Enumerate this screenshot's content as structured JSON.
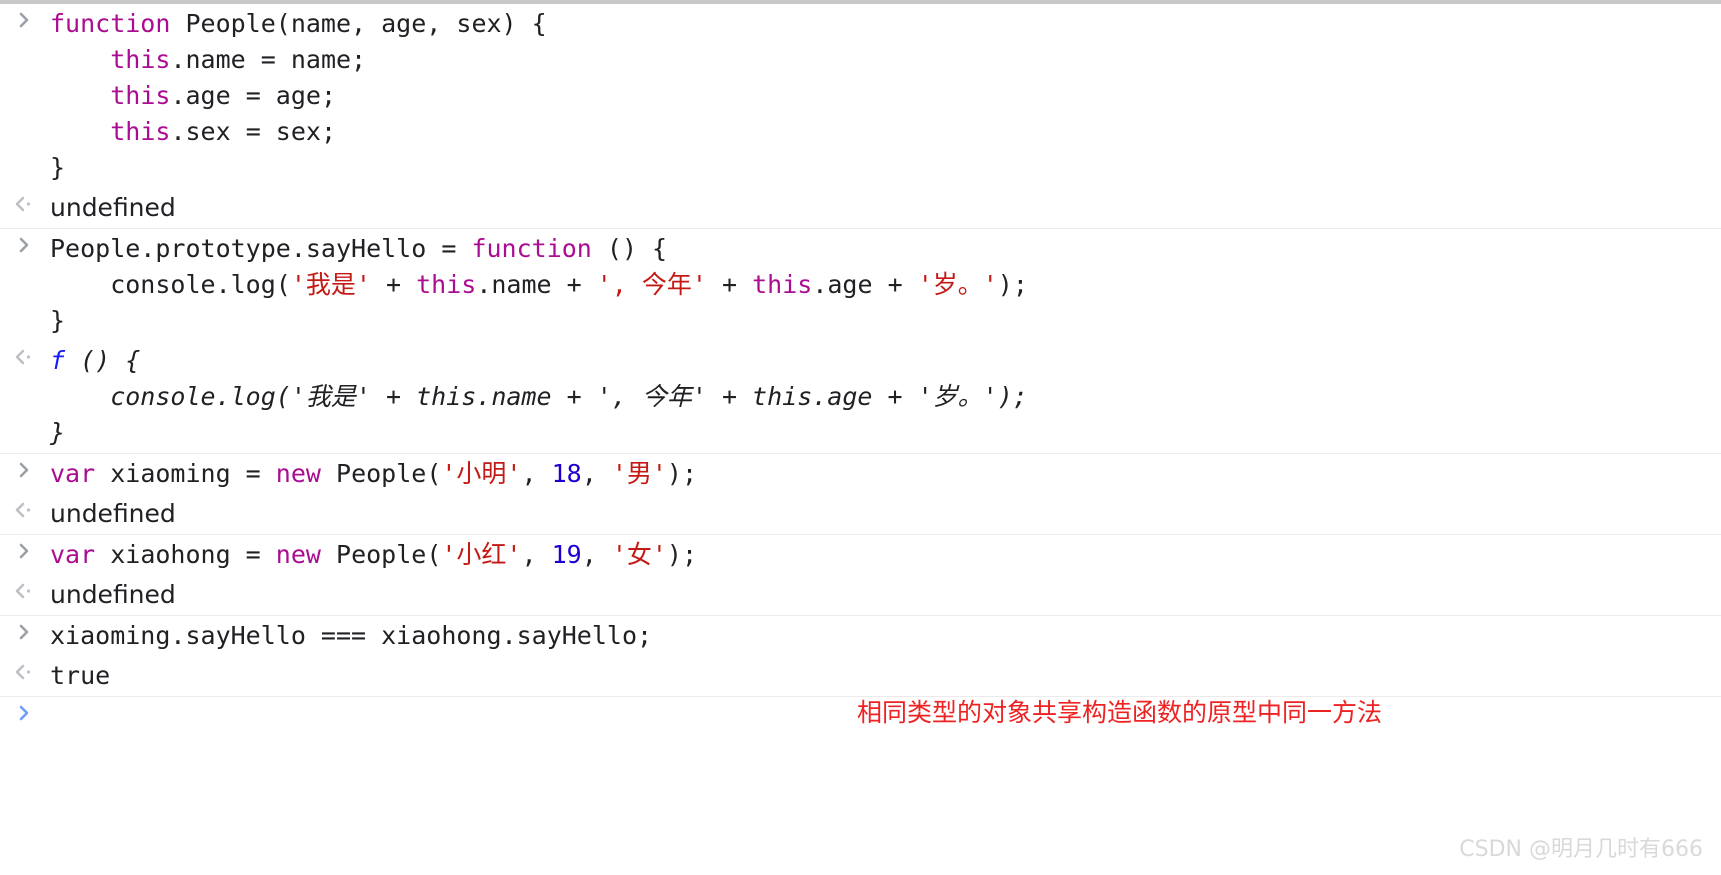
{
  "app": {
    "name": "Chrome DevTools Console",
    "theme": "light"
  },
  "colors": {
    "keyword": "#aa0d91",
    "string": "#c41a16",
    "number": "#1c00cf",
    "plain": "#202124",
    "result_muted": "#9aa0a6",
    "boolean": "#1c00cf",
    "function_glyph": "#1a1aff",
    "annotation_red": "#ee2222",
    "divider": "#ebebeb",
    "watermark": "#d9d9d9",
    "active_prompt": "#6ca0f5",
    "top_bar": "#c8c8c8"
  },
  "icons": {
    "input_prompt": "chevron-right-icon",
    "output_prompt": "chevron-left-dot-icon",
    "active_prompt": "chevron-right-icon"
  },
  "entries": [
    {
      "id": "entry-1",
      "input": {
        "lines": [
          [
            {
              "t": "function ",
              "c": "kw"
            },
            {
              "t": "People(name, age, sex) {",
              "c": "plain"
            }
          ],
          [
            {
              "t": "    ",
              "c": "plain"
            },
            {
              "t": "this",
              "c": "kw"
            },
            {
              "t": ".name = name;",
              "c": "plain"
            }
          ],
          [
            {
              "t": "    ",
              "c": "plain"
            },
            {
              "t": "this",
              "c": "kw"
            },
            {
              "t": ".age = age;",
              "c": "plain"
            }
          ],
          [
            {
              "t": "    ",
              "c": "plain"
            },
            {
              "t": "this",
              "c": "kw"
            },
            {
              "t": ".sex = sex;",
              "c": "plain"
            }
          ],
          [
            {
              "t": "}",
              "c": "plain"
            }
          ]
        ]
      },
      "output": {
        "kind": "muted",
        "lines": [
          [
            {
              "t": "undefined",
              "c": "plain"
            }
          ]
        ]
      }
    },
    {
      "id": "entry-2",
      "input": {
        "lines": [
          [
            {
              "t": "People.prototype.sayHello = ",
              "c": "plain"
            },
            {
              "t": "function ",
              "c": "kw"
            },
            {
              "t": "() {",
              "c": "plain"
            }
          ],
          [
            {
              "t": "    console.log(",
              "c": "plain"
            },
            {
              "t": "'我是'",
              "c": "str"
            },
            {
              "t": " + ",
              "c": "plain"
            },
            {
              "t": "this",
              "c": "kw"
            },
            {
              "t": ".name + ",
              "c": "plain"
            },
            {
              "t": "', 今年'",
              "c": "str"
            },
            {
              "t": " + ",
              "c": "plain"
            },
            {
              "t": "this",
              "c": "kw"
            },
            {
              "t": ".age + ",
              "c": "plain"
            },
            {
              "t": "'岁。'",
              "c": "str"
            },
            {
              "t": ");",
              "c": "plain"
            }
          ],
          [
            {
              "t": "}",
              "c": "plain"
            }
          ]
        ]
      },
      "output": {
        "kind": "function",
        "lines": [
          [
            {
              "t": "f",
              "c": "fkw"
            },
            {
              "t": " () {",
              "c": "plain"
            }
          ],
          [
            {
              "t": "    console.log('我是' + this.name + ', 今年' + this.age + '岁。');",
              "c": "plain"
            }
          ],
          [
            {
              "t": "}",
              "c": "plain"
            }
          ]
        ]
      }
    },
    {
      "id": "entry-3",
      "input": {
        "lines": [
          [
            {
              "t": "var ",
              "c": "kw"
            },
            {
              "t": "xiaoming = ",
              "c": "plain"
            },
            {
              "t": "new ",
              "c": "kw"
            },
            {
              "t": "People(",
              "c": "plain"
            },
            {
              "t": "'小明'",
              "c": "str"
            },
            {
              "t": ", ",
              "c": "plain"
            },
            {
              "t": "18",
              "c": "num"
            },
            {
              "t": ", ",
              "c": "plain"
            },
            {
              "t": "'男'",
              "c": "str"
            },
            {
              "t": ");",
              "c": "plain"
            }
          ]
        ]
      },
      "output": {
        "kind": "muted",
        "lines": [
          [
            {
              "t": "undefined",
              "c": "plain"
            }
          ]
        ]
      }
    },
    {
      "id": "entry-4",
      "input": {
        "lines": [
          [
            {
              "t": "var ",
              "c": "kw"
            },
            {
              "t": "xiaohong = ",
              "c": "plain"
            },
            {
              "t": "new ",
              "c": "kw"
            },
            {
              "t": "People(",
              "c": "plain"
            },
            {
              "t": "'小红'",
              "c": "str"
            },
            {
              "t": ", ",
              "c": "plain"
            },
            {
              "t": "19",
              "c": "num"
            },
            {
              "t": ", ",
              "c": "plain"
            },
            {
              "t": "'女'",
              "c": "str"
            },
            {
              "t": ");",
              "c": "plain"
            }
          ]
        ]
      },
      "output": {
        "kind": "muted",
        "lines": [
          [
            {
              "t": "undefined",
              "c": "plain"
            }
          ]
        ]
      }
    },
    {
      "id": "entry-5",
      "input": {
        "lines": [
          [
            {
              "t": "xiaoming.sayHello === xiaohong.sayHello;",
              "c": "plain"
            }
          ]
        ]
      },
      "output": {
        "kind": "boolean",
        "lines": [
          [
            {
              "t": "true",
              "c": "plain"
            }
          ]
        ]
      }
    }
  ],
  "active_prompt": {
    "value": "",
    "placeholder": ""
  },
  "annotation": {
    "text": "相同类型的对象共享构造函数的原型中同一方法"
  },
  "watermark": {
    "text": "CSDN @明月几时有666"
  }
}
